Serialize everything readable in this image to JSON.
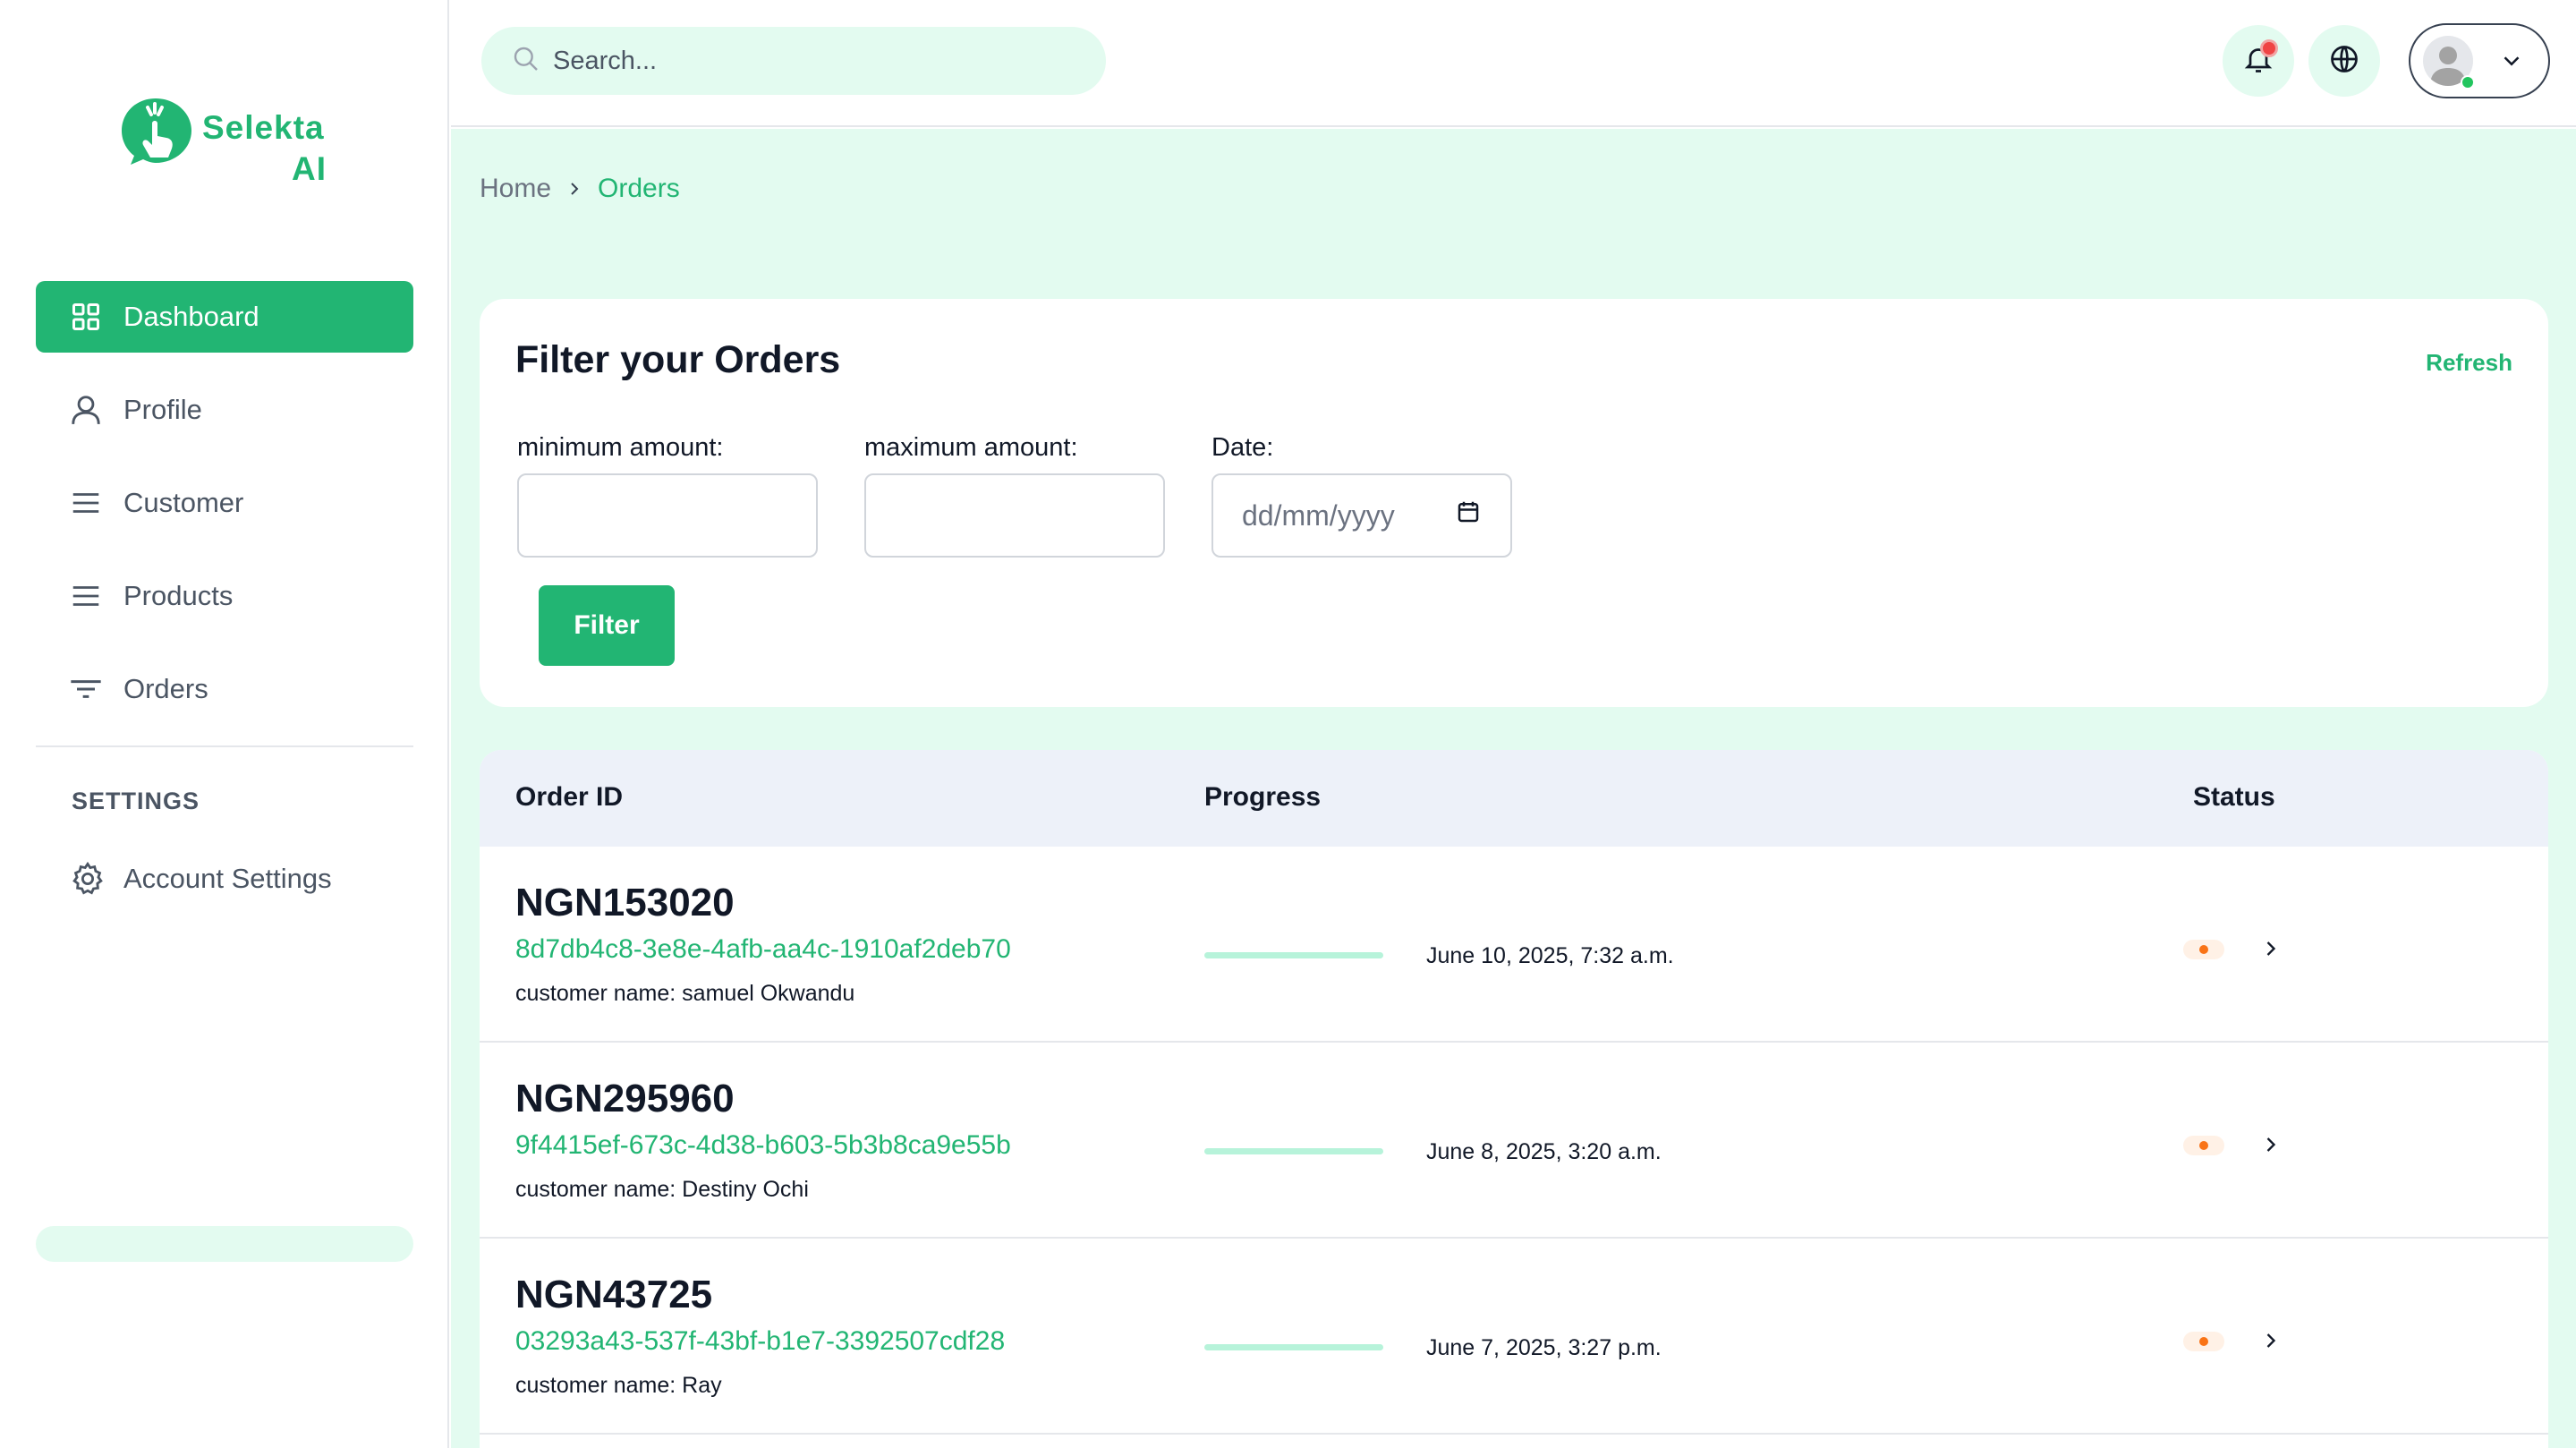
{
  "brand": {
    "name_line1": "Selekta",
    "name_line2": "AI",
    "accent": "#22b573"
  },
  "sidebar": {
    "items": [
      {
        "label": "Dashboard",
        "icon": "grid-icon",
        "active": true
      },
      {
        "label": "Profile",
        "icon": "user-icon"
      },
      {
        "label": "Customer",
        "icon": "menu-icon"
      },
      {
        "label": "Products",
        "icon": "menu-icon"
      },
      {
        "label": "Orders",
        "icon": "filter-icon"
      }
    ],
    "settings_title": "SETTINGS",
    "settings_item": {
      "label": "Account Settings",
      "icon": "gear-icon"
    }
  },
  "header": {
    "search_placeholder": "Search...",
    "icons": [
      "bell-icon",
      "globe-icon",
      "avatar",
      "chevron-down-icon"
    ]
  },
  "breadcrumb": {
    "home": "Home",
    "current": "Orders"
  },
  "filter": {
    "title": "Filter your Orders",
    "refresh_label": "Refresh",
    "min_label": "minimum amount:",
    "max_label": "maximum amount:",
    "date_label": "Date:",
    "date_placeholder": "dd/mm/yyyy",
    "button_label": "Filter"
  },
  "table": {
    "headers": {
      "order_id": "Order ID",
      "progress": "Progress",
      "status": "Status"
    },
    "rows": [
      {
        "order_id": "NGN153020",
        "uuid": "8d7db4c8-3e8e-4afb-aa4c-1910af2deb70",
        "customer": "customer name: samuel Okwandu",
        "date": "June 10, 2025, 7:32 a.m.",
        "status_color": "#f97316"
      },
      {
        "order_id": "NGN295960",
        "uuid": "9f4415ef-673c-4d38-b603-5b3b8ca9e55b",
        "customer": "customer name: Destiny Ochi",
        "date": "June 8, 2025, 3:20 a.m.",
        "status_color": "#f97316"
      },
      {
        "order_id": "NGN43725",
        "uuid": "03293a43-537f-43bf-b1e7-3392507cdf28",
        "customer": "customer name: Ray",
        "date": "June 7, 2025, 3:27 p.m.",
        "status_color": "#f97316"
      }
    ]
  }
}
